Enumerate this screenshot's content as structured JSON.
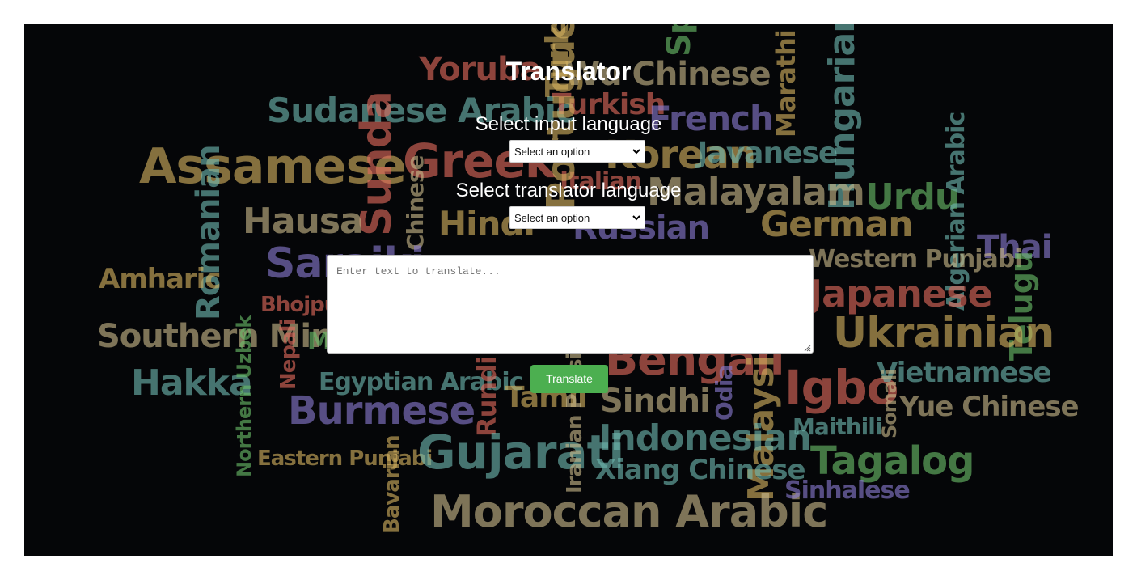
{
  "page": {
    "title": "Translator",
    "input_language_label": "Select input language",
    "translator_language_label": "Select translator language",
    "input_language_select": {
      "selected": "Select an option"
    },
    "translator_language_select": {
      "selected": "Select an option"
    },
    "text_input": {
      "placeholder": "Enter text to translate...",
      "value": ""
    },
    "translate_button_label": "Translate"
  },
  "background_words": [
    "Yoruba",
    "Wu Chinese",
    "Sudanese Arabic",
    "Turkish",
    "French",
    "Marathi",
    "Hungarian",
    "Assamese",
    "Sunda",
    "Greek",
    "Korean",
    "Javanese",
    "Urdu",
    "Algerian Arabic",
    "Hausa",
    "Chinese",
    "Hindi",
    "Italian",
    "Malayalam",
    "Russian",
    "German",
    "Romanian",
    "Thai",
    "Amharic",
    "Saraiki",
    "Western Punjabi",
    "Japanese",
    "Bhojpuri",
    "Telugu",
    "Southern Min",
    "Nepali",
    "Mandarin Chinese",
    "Bengali",
    "Ukrainian",
    "Hakka",
    "Egyptian Arabic",
    "Igbo",
    "Vietnamese",
    "Northern Uzbek",
    "Burmese",
    "Rundi",
    "Tamil",
    "Sindhi",
    "Odia",
    "Malaysian",
    "Maithili",
    "Somali",
    "Yue Chinese",
    "Eastern Punjabi",
    "Gujarati",
    "Iranian Persian",
    "Indonesian",
    "Xiang Chinese",
    "Tagalog",
    "Bavarian",
    "Moroccan Arabic",
    "Sinhalese",
    "Portuguese",
    "Spanish",
    "Turkish"
  ],
  "colors": {
    "background": "#050608",
    "button": "#4caf50",
    "word_palette": [
      "#d4b25f",
      "#6fb8b0",
      "#e06a5c",
      "#8a7bd1",
      "#c8b88a",
      "#6bbf6a",
      "#d88f4f"
    ]
  },
  "icons": {
    "select_chevron": "chevron-down-icon",
    "resize_grip": "resize-grip-icon"
  }
}
